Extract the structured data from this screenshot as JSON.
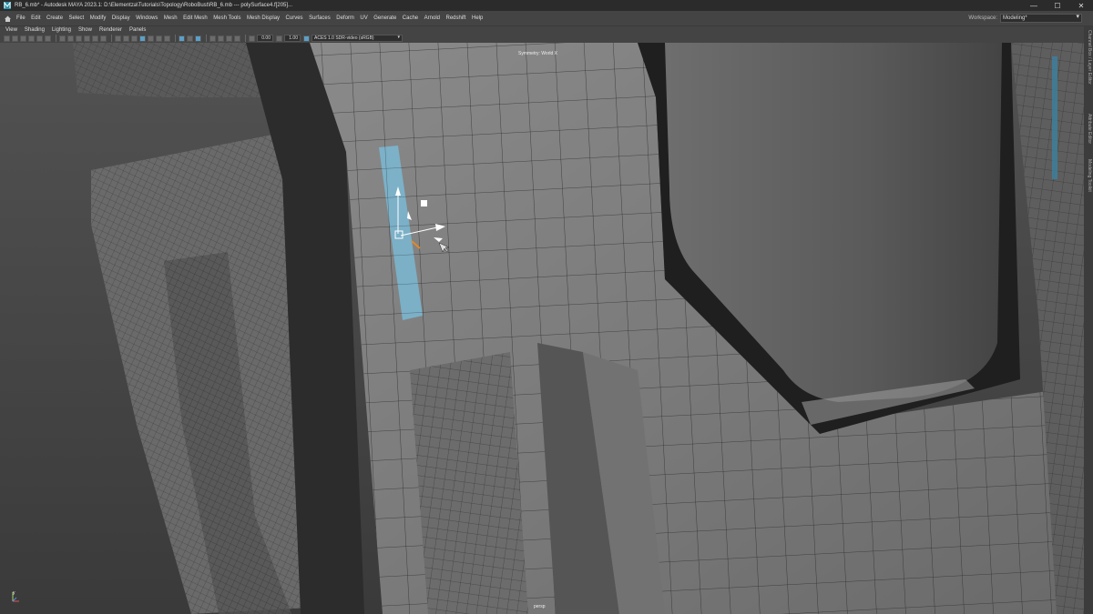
{
  "window": {
    "title": "RB_6.mb* - Autodesk MAYA 2023.1: D:\\Elementza\\Tutorials\\Topology\\RoboBust\\RB_6.mb   ---   polySurface4.f[205]...",
    "controls": {
      "minimize": "—",
      "maximize": "☐",
      "close": "✕"
    }
  },
  "menubar": {
    "items": [
      "File",
      "Edit",
      "Create",
      "Select",
      "Modify",
      "Display",
      "Windows",
      "Mesh",
      "Edit Mesh",
      "Mesh Tools",
      "Mesh Display",
      "Curves",
      "Surfaces",
      "Deform",
      "UV",
      "Generate",
      "Cache",
      "Arnold",
      "Redshift",
      "Help"
    ],
    "workspace_label": "Workspace:",
    "workspace_value": "Modeling*"
  },
  "panel_menu": {
    "items": [
      "View",
      "Shading",
      "Lighting",
      "Show",
      "Renderer",
      "Panels"
    ]
  },
  "toolbar": {
    "field_1": "0.00",
    "field_2": "1.00",
    "color_space": "ACES 1.0 SDR-video (sRGB)"
  },
  "viewport": {
    "symmetry_label": "Symmetry: World X",
    "camera_label": "persp",
    "selection_color": "#7ab8d4",
    "axis_label": "y"
  },
  "side_tabs": [
    "Channel Box / Layer Editor",
    "Attribute Editor",
    "Modeling Toolkit"
  ]
}
